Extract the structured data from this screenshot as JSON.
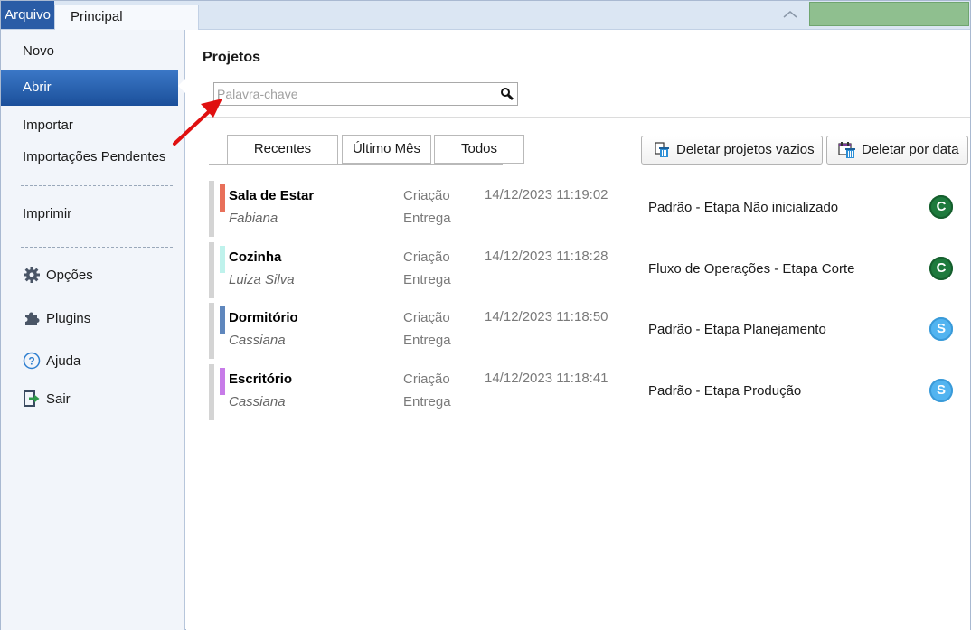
{
  "ribbon": {
    "arquivo": "Arquivo",
    "tab_principal": "Principal"
  },
  "sidebar": {
    "items": [
      {
        "label": "Novo"
      },
      {
        "label": "Abrir"
      },
      {
        "label": "Importar"
      },
      {
        "label": "Importações Pendentes"
      },
      {
        "label": "Imprimir"
      },
      {
        "label": "Opções",
        "icon": "gear-icon"
      },
      {
        "label": "Plugins",
        "icon": "puzzle-icon"
      },
      {
        "label": "Ajuda",
        "icon": "help-icon"
      },
      {
        "label": "Sair",
        "icon": "exit-icon"
      }
    ]
  },
  "main": {
    "title": "Projetos",
    "search_placeholder": "Palavra-chave",
    "tabs": [
      "Recentes",
      "Último Mês",
      "Todos"
    ],
    "buttons": {
      "delete_empty": "Deletar projetos vazios",
      "delete_by_date": "Deletar por data"
    },
    "rows": [
      {
        "name": "Sala de Estar",
        "owner": "Fabiana",
        "label1": "Criação",
        "label2": "Entrega",
        "date": "14/12/2023 11:19:02",
        "stage": "Padrão - Etapa Não inicializado",
        "badge": "C",
        "color": "#e8705a"
      },
      {
        "name": "Cozinha",
        "owner": "Luiza Silva",
        "label1": "Criação",
        "label2": "Entrega",
        "date": "14/12/2023 11:18:28",
        "stage": "Fluxo de Operações - Etapa Corte",
        "badge": "C",
        "color": "#bff2ec"
      },
      {
        "name": "Dormitório",
        "owner": "Cassiana",
        "label1": "Criação",
        "label2": "Entrega",
        "date": "14/12/2023 11:18:50",
        "stage": "Padrão - Etapa Planejamento",
        "badge": "S",
        "color": "#5f87bd"
      },
      {
        "name": "Escritório",
        "owner": "Cassiana",
        "label1": "Criação",
        "label2": "Entrega",
        "date": "14/12/2023 11:18:41",
        "stage": "Padrão - Etapa Produção",
        "badge": "S",
        "color": "#c77be8"
      }
    ]
  }
}
